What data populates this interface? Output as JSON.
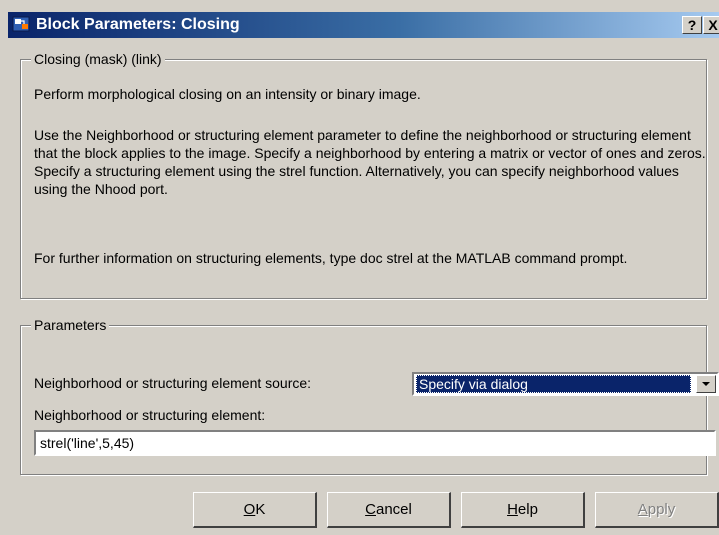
{
  "window": {
    "title": "Block Parameters: Closing",
    "help_glyph": "?",
    "close_glyph": "X"
  },
  "description_group": {
    "legend": "Closing (mask) (link)",
    "paragraphs": [
      "Perform morphological closing on an intensity or binary image.",
      "Use the Neighborhood or structuring element parameter to define the neighborhood or structuring element that the block applies to the image.  Specify a neighborhood by entering a matrix or vector of ones and zeros.  Specify a structuring element using the strel function.  Alternatively, you can specify neighborhood values using the Nhood port.",
      "For further information on structuring elements, type doc strel at the MATLAB command prompt."
    ]
  },
  "parameters_group": {
    "legend": "Parameters",
    "source_label": "Neighborhood or structuring element source:",
    "source_value": "Specify via dialog",
    "element_label": "Neighborhood or structuring element:",
    "element_value": "strel('line',5,45)"
  },
  "buttons": {
    "ok": {
      "first": "O",
      "rest": "K"
    },
    "cancel": {
      "first": "C",
      "rest": "ancel"
    },
    "help": {
      "first": "H",
      "rest": "elp"
    },
    "apply": {
      "first": "A",
      "rest": "pply"
    }
  },
  "icons": {
    "window_icon": "simulink-block-icon",
    "dropdown": "chevron-down-icon"
  },
  "colors": {
    "titlebar_start": "#0a246a",
    "titlebar_end": "#a6caf0",
    "face": "#d4d0c8",
    "selection": "#0a246a"
  }
}
